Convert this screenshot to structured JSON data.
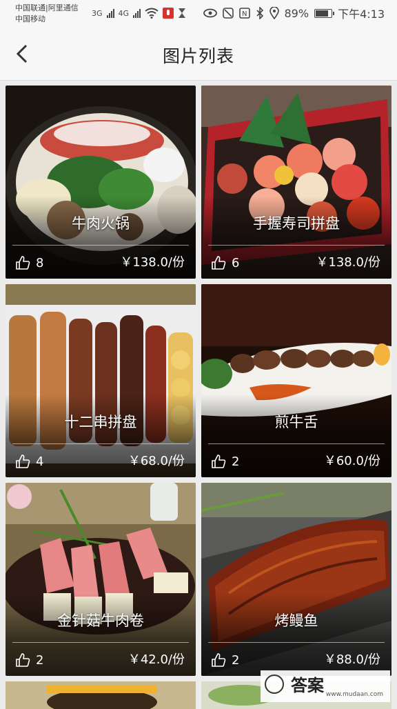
{
  "status_bar": {
    "carrier_line1": "中国联通|阿里通信",
    "carrier_line2": "中国移动",
    "net1": "3G",
    "net2": "4G",
    "battery": "89%",
    "time": "下午4:13"
  },
  "nav": {
    "title": "图片列表"
  },
  "items": [
    {
      "name": "牛肉火锅",
      "likes": "8",
      "price": "￥138.0/份"
    },
    {
      "name": "手握寿司拼盘",
      "likes": "6",
      "price": "￥138.0/份"
    },
    {
      "name": "十二串拼盘",
      "likes": "4",
      "price": "￥68.0/份"
    },
    {
      "name": "煎牛舌",
      "likes": "2",
      "price": "￥60.0/份"
    },
    {
      "name": "金针菇牛肉卷",
      "likes": "2",
      "price": "￥42.0/份"
    },
    {
      "name": "烤鳗鱼",
      "likes": "2",
      "price": "￥88.0/份"
    }
  ],
  "watermark": {
    "text": "答案",
    "url": "www.mudaan.com"
  },
  "colors": {
    "background": "#ececec",
    "bar": "#f7f7f7"
  }
}
